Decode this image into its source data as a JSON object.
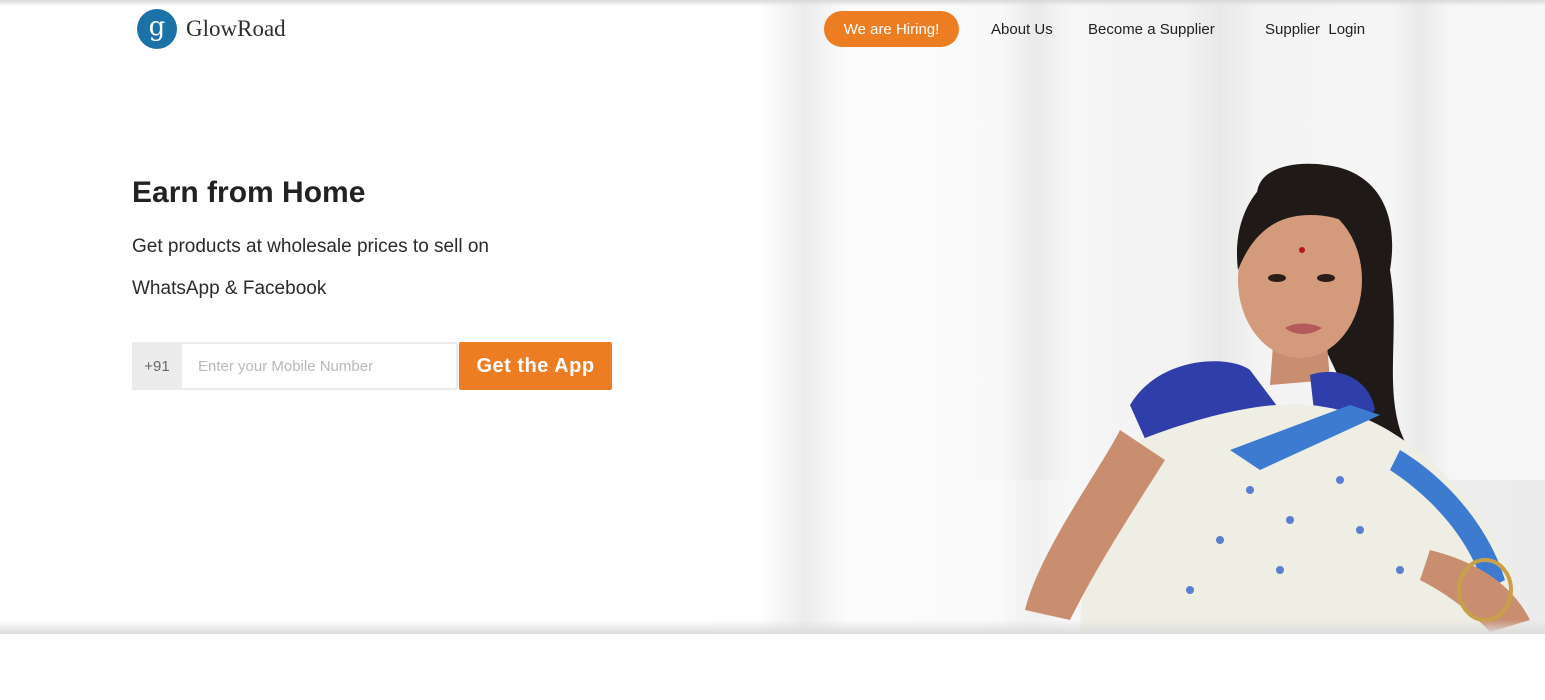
{
  "header": {
    "brand": "GlowRoad",
    "logo_letter": "g",
    "hiring_label": "We are Hiring!",
    "nav": {
      "about": "About Us",
      "supplier": "Become a Supplier",
      "login": "Supplier  Login"
    }
  },
  "hero": {
    "title": "Earn from Home",
    "subtitle_line1": "Get products at wholesale prices to sell on",
    "subtitle_line2": "WhatsApp & Facebook"
  },
  "form": {
    "country_code": "+91",
    "mobile_placeholder": "Enter your Mobile Number",
    "mobile_value": "",
    "cta_label": "Get the App"
  },
  "colors": {
    "accent": "#ed7d22",
    "brand_blue": "#1a72a8"
  },
  "icons": {
    "logo": "glowroad-logo-icon"
  }
}
